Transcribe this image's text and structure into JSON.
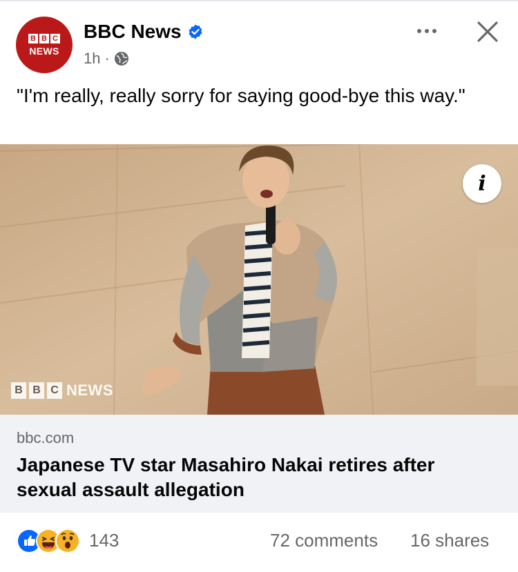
{
  "post": {
    "page_name": "BBC News",
    "time_ago": "1h",
    "separator": "·",
    "caption": "\"I'm really, really sorry for saying good-bye this way.\"",
    "avatar": {
      "blocks": [
        "B",
        "B",
        "C"
      ],
      "word": "NEWS"
    },
    "icons": {
      "verified": "verified-badge-icon",
      "audience": "globe-icon",
      "more": "more-options-icon",
      "close": "close-icon",
      "info": "info-icon"
    }
  },
  "image": {
    "watermark_blocks": [
      "B",
      "B",
      "C"
    ],
    "watermark_word": "NEWS",
    "info_glyph": "i"
  },
  "link_preview": {
    "domain": "bbc.com",
    "title": "Japanese TV star Masahiro Nakai retires after sexual assault allegation"
  },
  "engagement": {
    "reaction_types": [
      "like",
      "haha",
      "wow"
    ],
    "reaction_count": "143",
    "comments": "72 comments",
    "shares": "16 shares"
  },
  "colors": {
    "bbc_red": "#bb1919",
    "verified_blue": "#0866ff",
    "secondary_text": "#65676b",
    "link_box_bg": "#f0f2f5"
  }
}
